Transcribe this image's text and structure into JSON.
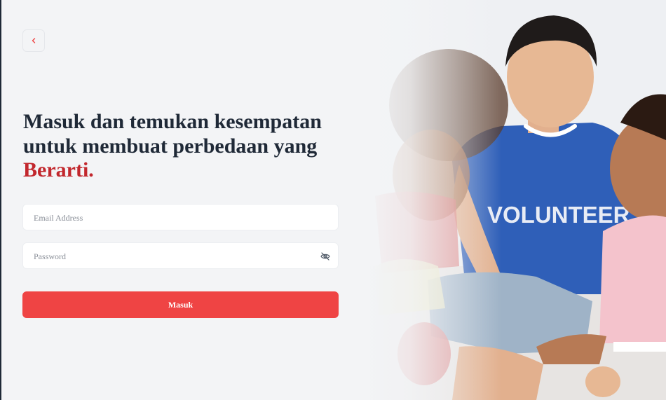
{
  "back_button": {
    "icon": "chevron-left-icon",
    "color": "#ef4444"
  },
  "headline": {
    "line1": "Masuk dan temukan kesempatan",
    "line2": "untuk membuat perbedaan yang",
    "accent": "Berarti."
  },
  "email_field": {
    "placeholder": "Email Address",
    "value": ""
  },
  "password_field": {
    "placeholder": "Password",
    "value": "",
    "toggle_icon": "eye-off-icon"
  },
  "submit_button": {
    "label": "Masuk",
    "color": "#ef4444"
  },
  "hero_image": {
    "shirt_text": "VOLUNTEER",
    "shirt_color": "#2f5fb8"
  },
  "colors": {
    "accent": "#c2272d",
    "background": "#f3f4f6",
    "heading": "#1f2937"
  }
}
